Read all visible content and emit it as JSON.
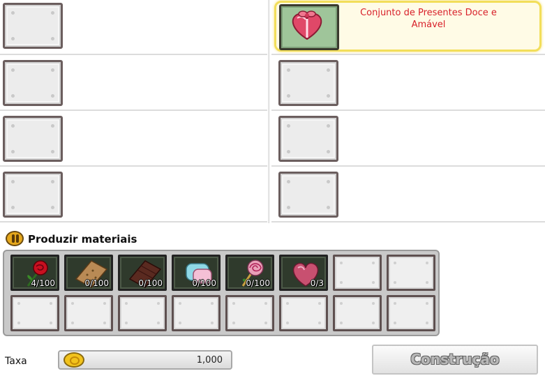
{
  "recipes": {
    "selected_name": "Conjunto de Presentes Doce e Amável"
  },
  "materials": {
    "title": "Produzir materiais",
    "items": [
      {
        "icon": "rose-icon",
        "count": "4/100"
      },
      {
        "icon": "biscuit-icon",
        "count": "0/100"
      },
      {
        "icon": "chocolate-bar-icon",
        "count": "0/100"
      },
      {
        "icon": "marshmallow-icon",
        "count": "0/100"
      },
      {
        "icon": "lollipop-icon",
        "count": "0/100"
      },
      {
        "icon": "heart-chocolate-icon",
        "count": "0/3"
      }
    ]
  },
  "fee": {
    "label": "Taxa",
    "value": "1,000"
  },
  "actions": {
    "build_label": "Construção"
  },
  "colors": {
    "accent_selected": "#f2de5a",
    "recipe_name": "#d8202a"
  }
}
